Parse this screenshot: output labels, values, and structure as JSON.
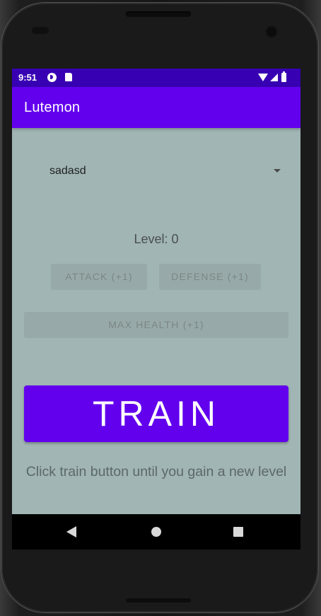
{
  "status_bar": {
    "time": "9:51"
  },
  "app_bar": {
    "title": "Lutemon"
  },
  "spinner": {
    "selected": "sadasd"
  },
  "level": {
    "text": "Level: 0"
  },
  "buttons": {
    "attack": "ATTACK (+1)",
    "defense": "DEFENSE (+1)",
    "max_health": "MAX HEALTH (+1)",
    "train": "TRAIN"
  },
  "hint": {
    "text": "Click train button until you gain a new level"
  },
  "colors": {
    "primary": "#6200ee",
    "primary_dark": "#3700b3",
    "background": "#a0b5b4"
  },
  "icons": {
    "status_left": [
      "status-app-icon",
      "sd-card-icon"
    ],
    "status_right": [
      "wifi-icon",
      "signal-icon",
      "battery-icon"
    ],
    "navigation": [
      "back-icon",
      "home-icon",
      "recents-icon"
    ]
  }
}
